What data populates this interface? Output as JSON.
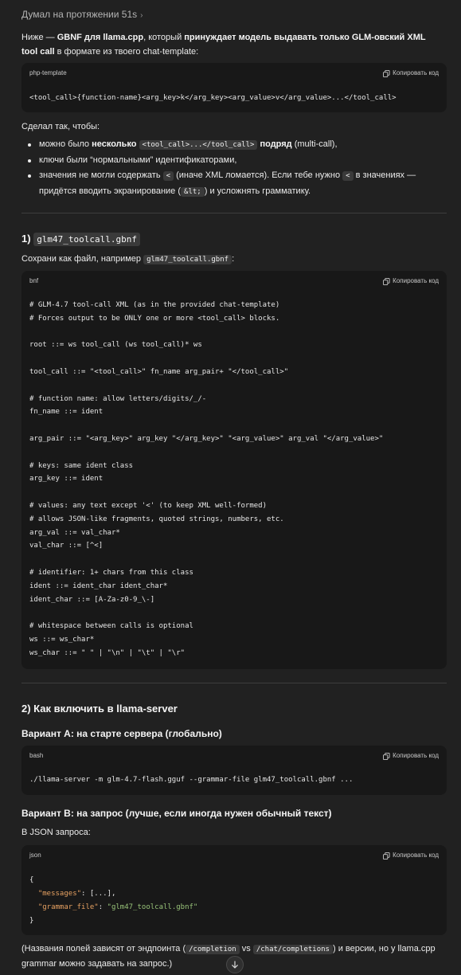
{
  "thought": {
    "label": "Думал на протяжении 51s",
    "chevron": "›"
  },
  "intro": {
    "p1_a": "Ниже — ",
    "p1_b": "GBNF для llama.cpp",
    "p1_c": ", который ",
    "p1_d": "принуждает модель выдавать только GLM-овский XML tool call",
    "p1_e": " в формате из твоего chat-template:"
  },
  "copy_label": "Копировать код",
  "code1": {
    "lang": "php-template",
    "text": "<tool_call>{function-name}<arg_key>k</arg_key><arg_value>v</arg_value>...</tool_call>"
  },
  "made_so": "Сделал так, чтобы:",
  "bullets": {
    "b1_a": "можно было ",
    "b1_b": "несколько",
    "b1_code": "<tool_call>...</tool_call>",
    "b1_c": "подряд",
    "b1_d": " (multi-call),",
    "b2": "ключи были “нормальными” идентификаторами,",
    "b3_a": "значения не могли содержать ",
    "b3_code1": "<",
    "b3_b": " (иначе XML ломается). Если тебе нужно ",
    "b3_code2": "<",
    "b3_c": " в значениях — придётся вводить экранирование (",
    "b3_code3": "&lt;",
    "b3_d": ") и усложнять грамматику."
  },
  "section1": {
    "prefix": "1)",
    "code": "glm47_toolcall.gbnf"
  },
  "save_as": {
    "text": "Сохрани как файл, например ",
    "code": "glm47_toolcall.gbnf",
    "suffix": ":"
  },
  "code2": {
    "lang": "bnf",
    "text": "# GLM-4.7 tool-call XML (as in the provided chat-template)\n# Forces output to be ONLY one or more <tool_call> blocks.\n\nroot ::= ws tool_call (ws tool_call)* ws\n\ntool_call ::= \"<tool_call>\" fn_name arg_pair+ \"</tool_call>\"\n\n# function name: allow letters/digits/_/-\nfn_name ::= ident\n\narg_pair ::= \"<arg_key>\" arg_key \"</arg_key>\" \"<arg_value>\" arg_val \"</arg_value>\"\n\n# keys: same ident class\narg_key ::= ident\n\n# values: any text except '<' (to keep XML well-formed)\n# allows JSON-like fragments, quoted strings, numbers, etc.\narg_val ::= val_char*\nval_char ::= [^<]\n\n# identifier: 1+ chars from this class\nident ::= ident_char ident_char*\nident_char ::= [A-Za-z0-9_\\-]\n\n# whitespace between calls is optional\nws ::= ws_char*\nws_char ::= \" \" | \"\\n\" | \"\\t\" | \"\\r\""
  },
  "section2": "2) Как включить в llama-server",
  "variantA": "Вариант A: на старте сервера (глобально)",
  "code3": {
    "lang": "bash",
    "text": "./llama-server -m glm-4.7-flash.gguf --grammar-file glm47_toolcall.gbnf ..."
  },
  "variantB": "Вариант B: на запрос (лучше, если иногда нужен обычный текст)",
  "json_req": "В JSON запроса:",
  "code4": {
    "lang": "json",
    "open": "{",
    "k1": "\"messages\"",
    "v1": ": [...],",
    "k2": "\"grammar_file\"",
    "colon": ": ",
    "v2": "\"glm47_toolcall.gbnf\"",
    "close": "}"
  },
  "footer": {
    "a": "(Названия полей зависят от эндпоинта (",
    "c1": "/completion",
    "b": " vs ",
    "c2": "/chat/completions",
    "c": ") и версии, но у llama.cpp grammar можно задавать на запрос.)"
  },
  "icons": {
    "copy": "copy-icon",
    "scroll": "arrow-down-icon"
  },
  "colors": {
    "background": "#212121",
    "code_bg": "#181818",
    "json_key": "#e8a262",
    "json_string": "#98c379"
  }
}
